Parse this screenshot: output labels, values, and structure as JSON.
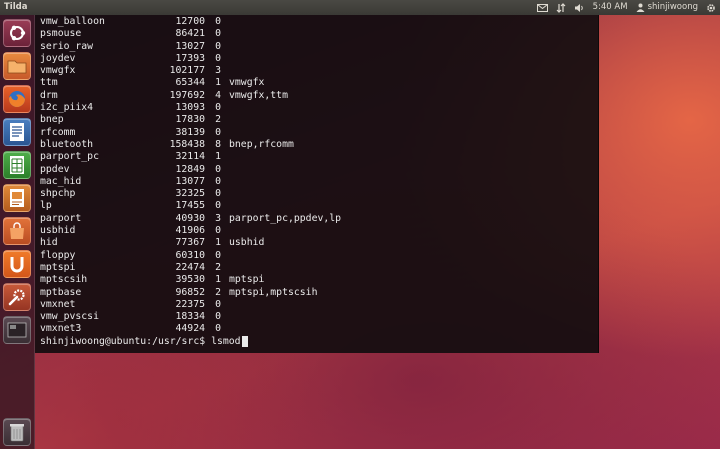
{
  "panel": {
    "app_title": "Tilda",
    "clock": "5:40 AM",
    "username": "shinjiwoong"
  },
  "launcher": {
    "items": [
      {
        "name": "dash"
      },
      {
        "name": "files"
      },
      {
        "name": "firefox"
      },
      {
        "name": "libreoffice-writer"
      },
      {
        "name": "libreoffice-calc"
      },
      {
        "name": "libreoffice-impress"
      },
      {
        "name": "ubuntu-software-center"
      },
      {
        "name": "ubuntu-one"
      },
      {
        "name": "system-settings"
      },
      {
        "name": "workspace-switcher"
      },
      {
        "name": "trash"
      }
    ]
  },
  "terminal": {
    "modules": [
      {
        "name": "vmw_balloon",
        "size": "12700",
        "used": "0",
        "by": ""
      },
      {
        "name": "psmouse",
        "size": "86421",
        "used": "0",
        "by": ""
      },
      {
        "name": "serio_raw",
        "size": "13027",
        "used": "0",
        "by": ""
      },
      {
        "name": "joydev",
        "size": "17393",
        "used": "0",
        "by": ""
      },
      {
        "name": "vmwgfx",
        "size": "102177",
        "used": "3",
        "by": ""
      },
      {
        "name": "ttm",
        "size": "65344",
        "used": "1",
        "by": "vmwgfx"
      },
      {
        "name": "drm",
        "size": "197692",
        "used": "4",
        "by": "vmwgfx,ttm"
      },
      {
        "name": "i2c_piix4",
        "size": "13093",
        "used": "0",
        "by": ""
      },
      {
        "name": "bnep",
        "size": "17830",
        "used": "2",
        "by": ""
      },
      {
        "name": "rfcomm",
        "size": "38139",
        "used": "0",
        "by": ""
      },
      {
        "name": "bluetooth",
        "size": "158438",
        "used": "8",
        "by": "bnep,rfcomm"
      },
      {
        "name": "parport_pc",
        "size": "32114",
        "used": "1",
        "by": ""
      },
      {
        "name": "ppdev",
        "size": "12849",
        "used": "0",
        "by": ""
      },
      {
        "name": "mac_hid",
        "size": "13077",
        "used": "0",
        "by": ""
      },
      {
        "name": "shpchp",
        "size": "32325",
        "used": "0",
        "by": ""
      },
      {
        "name": "lp",
        "size": "17455",
        "used": "0",
        "by": ""
      },
      {
        "name": "parport",
        "size": "40930",
        "used": "3",
        "by": "parport_pc,ppdev,lp"
      },
      {
        "name": "usbhid",
        "size": "41906",
        "used": "0",
        "by": ""
      },
      {
        "name": "hid",
        "size": "77367",
        "used": "1",
        "by": "usbhid"
      },
      {
        "name": "floppy",
        "size": "60310",
        "used": "0",
        "by": ""
      },
      {
        "name": "mptspi",
        "size": "22474",
        "used": "2",
        "by": ""
      },
      {
        "name": "mptscsih",
        "size": "39530",
        "used": "1",
        "by": "mptspi"
      },
      {
        "name": "mptbase",
        "size": "96852",
        "used": "2",
        "by": "mptspi,mptscsih"
      },
      {
        "name": "vmxnet",
        "size": "22375",
        "used": "0",
        "by": ""
      },
      {
        "name": "vmw_pvscsi",
        "size": "18334",
        "used": "0",
        "by": ""
      },
      {
        "name": "vmxnet3",
        "size": "44924",
        "used": "0",
        "by": ""
      }
    ],
    "prompt": "shinjiwoong@ubuntu:/usr/src$ ",
    "command": "lsmod"
  }
}
